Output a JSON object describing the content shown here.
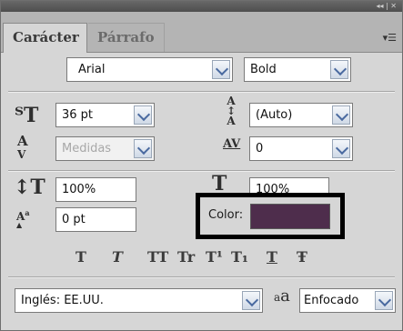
{
  "tabs": {
    "active": "Carácter",
    "inactive": "Párrafo"
  },
  "titlebar": {
    "controls": "◂◂ | ✕"
  },
  "font": {
    "family": "Arial",
    "style": "Bold"
  },
  "size": {
    "value": "36 pt"
  },
  "leading": {
    "value": "(Auto)"
  },
  "kerning": {
    "value": "Medidas"
  },
  "tracking": {
    "value": "0"
  },
  "scale": {
    "vertical": "100%",
    "horizontal": "100%"
  },
  "baseline": {
    "value": "0 pt"
  },
  "color": {
    "label": "Color:",
    "value": "#4e2d4c"
  },
  "styles": [
    "T",
    "T",
    "TT",
    "Tr",
    "T¹",
    "T₁",
    "T",
    "Ŧ"
  ],
  "language": {
    "value": "Inglés: EE.UU."
  },
  "antialias": {
    "icon": "aa",
    "value": "Enfocado"
  },
  "icons": {
    "size": "size-icon",
    "leading": "leading-icon",
    "kerning": "kerning-icon",
    "tracking": "tracking-icon",
    "vscale": "vertical-scale-icon",
    "hscale": "horizontal-scale-icon",
    "baseline": "baseline-shift-icon"
  }
}
